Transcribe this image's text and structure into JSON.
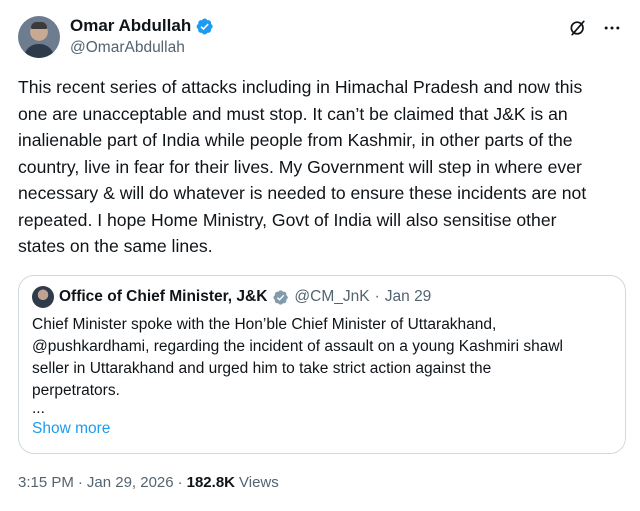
{
  "author": {
    "name": "Omar Abdullah",
    "handle": "@OmarAbdullah",
    "verified_color": "#1d9bf0"
  },
  "header_actions": {
    "grok_icon": "grok-icon",
    "more_icon": "more-icon"
  },
  "body": {
    "text": "This recent series of attacks including in Himachal Pradesh and now this\none are unacceptable and must stop. It can’t be claimed that J&K is an\ninalienable part of India while people from Kashmir, in other parts of the\ncountry, live in fear for their lives. My Government will step in where ever\nnecessary & will do whatever is needed to ensure these incidents are not\nrepeated. I hope Home Ministry, Govt of India will also sensitise other\nstates on the same lines."
  },
  "quote": {
    "name": "Office of Chief Minister, J&K",
    "handle": "@CM_JnK",
    "separator": "·",
    "date": "Jan 29",
    "badge_color": "#829aab",
    "text": "Chief Minister spoke with the Hon’ble Chief Minister of Uttarakhand,\n@pushkardhami, regarding the incident of assault on a young Kashmiri shawl\nseller in Uttarakhand and urged him to take strict action against the\nperpetrators.",
    "ellipsis": "...",
    "show_more": "Show more"
  },
  "meta": {
    "time": "3:15 PM",
    "sep1": "·",
    "date": "Jan 29, 2026",
    "sep2": "·",
    "views_count": "182.8K",
    "views_label": "Views"
  },
  "colors": {
    "link": "#1d9bf0",
    "secondary_text": "#536471",
    "border": "#cfd9de"
  }
}
